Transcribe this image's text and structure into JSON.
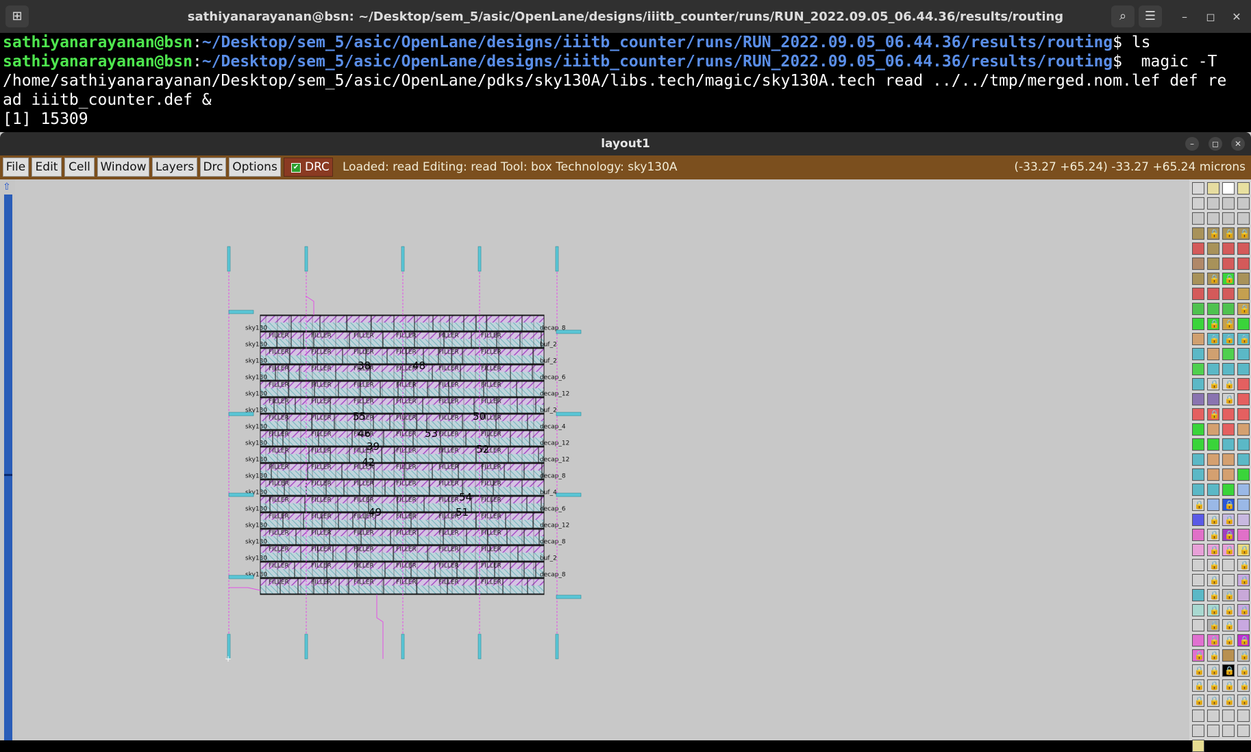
{
  "terminal": {
    "title": "sathiyanarayanan@bsn: ~/Desktop/sem_5/asic/OpenLane/designs/iiitb_counter/runs/RUN_2022.09.05_06.44.36/results/routing",
    "buttons": {
      "new_tab": "⊞",
      "search": "⌕",
      "menu": "☰",
      "minimize": "–",
      "maximize": "◻",
      "close": "✕"
    },
    "lines": [
      {
        "user": "sathiyanarayanan@bsn",
        "sep": ":",
        "path": "~/Desktop/sem_5/asic/OpenLane/designs/iiitb_counter/runs/RUN_2022.09.05_06.44.36/results/routing",
        "cmd": "$ ls"
      },
      {
        "user": "sathiyanarayanan@bsn",
        "sep": ":",
        "path": "~/Desktop/sem_5/asic/OpenLane/designs/iiitb_counter/runs/RUN_2022.09.05_06.44.36/results/routing",
        "cmd": "$  magic -T"
      }
    ],
    "wrap1": "/home/sathiyanarayanan/Desktop/sem_5/asic/OpenLane/pdks/sky130A/libs.tech/magic/sky130A.tech read ../../tmp/merged.nom.lef def re",
    "wrap2": "ad iiitb_counter.def &",
    "wrap3": "[1] 15309"
  },
  "magic": {
    "title": "layout1",
    "win_buttons": {
      "minimize": "–",
      "maximize": "◻",
      "close": "✕"
    },
    "menu": [
      "File",
      "Edit",
      "Cell",
      "Window",
      "Layers",
      "Drc",
      "Options"
    ],
    "drc_label": "DRC",
    "drc_checked": true,
    "status": "Loaded: read Editing: read Tool: box  Technology: sky130A",
    "coords": "(-33.27 +65.24) -33.27 +65.24 microns",
    "colors": {
      "menubar": "#7b4f1e",
      "canvas": "#c8c8c8",
      "scroll": "#2a5db8"
    }
  },
  "layout": {
    "row_labels_right": [
      "decap_8",
      "buf_2",
      "buf_2",
      "decap_6",
      "decap_12",
      "buf_2",
      "decap_4",
      "decap_12",
      "decap_12",
      "decap_8",
      "buf_4",
      "decap_6",
      "decap_12",
      "decap_8",
      "buf_2",
      "decap_8"
    ],
    "row_labels_left": [
      "sky130",
      "sky130",
      "sky130",
      "sky130_",
      "sky130_",
      "sky130",
      "sky130",
      "sky130_",
      "sky130",
      "sky130_",
      "sky130",
      "sky130_",
      "sky130_",
      "sky130_",
      "sky130",
      "sky130"
    ],
    "filler_label": "FILLER",
    "numbers": [
      "38",
      "48",
      "55",
      "50",
      "46",
      "53",
      "39",
      "52",
      "42",
      "54",
      "49",
      "51"
    ]
  }
}
